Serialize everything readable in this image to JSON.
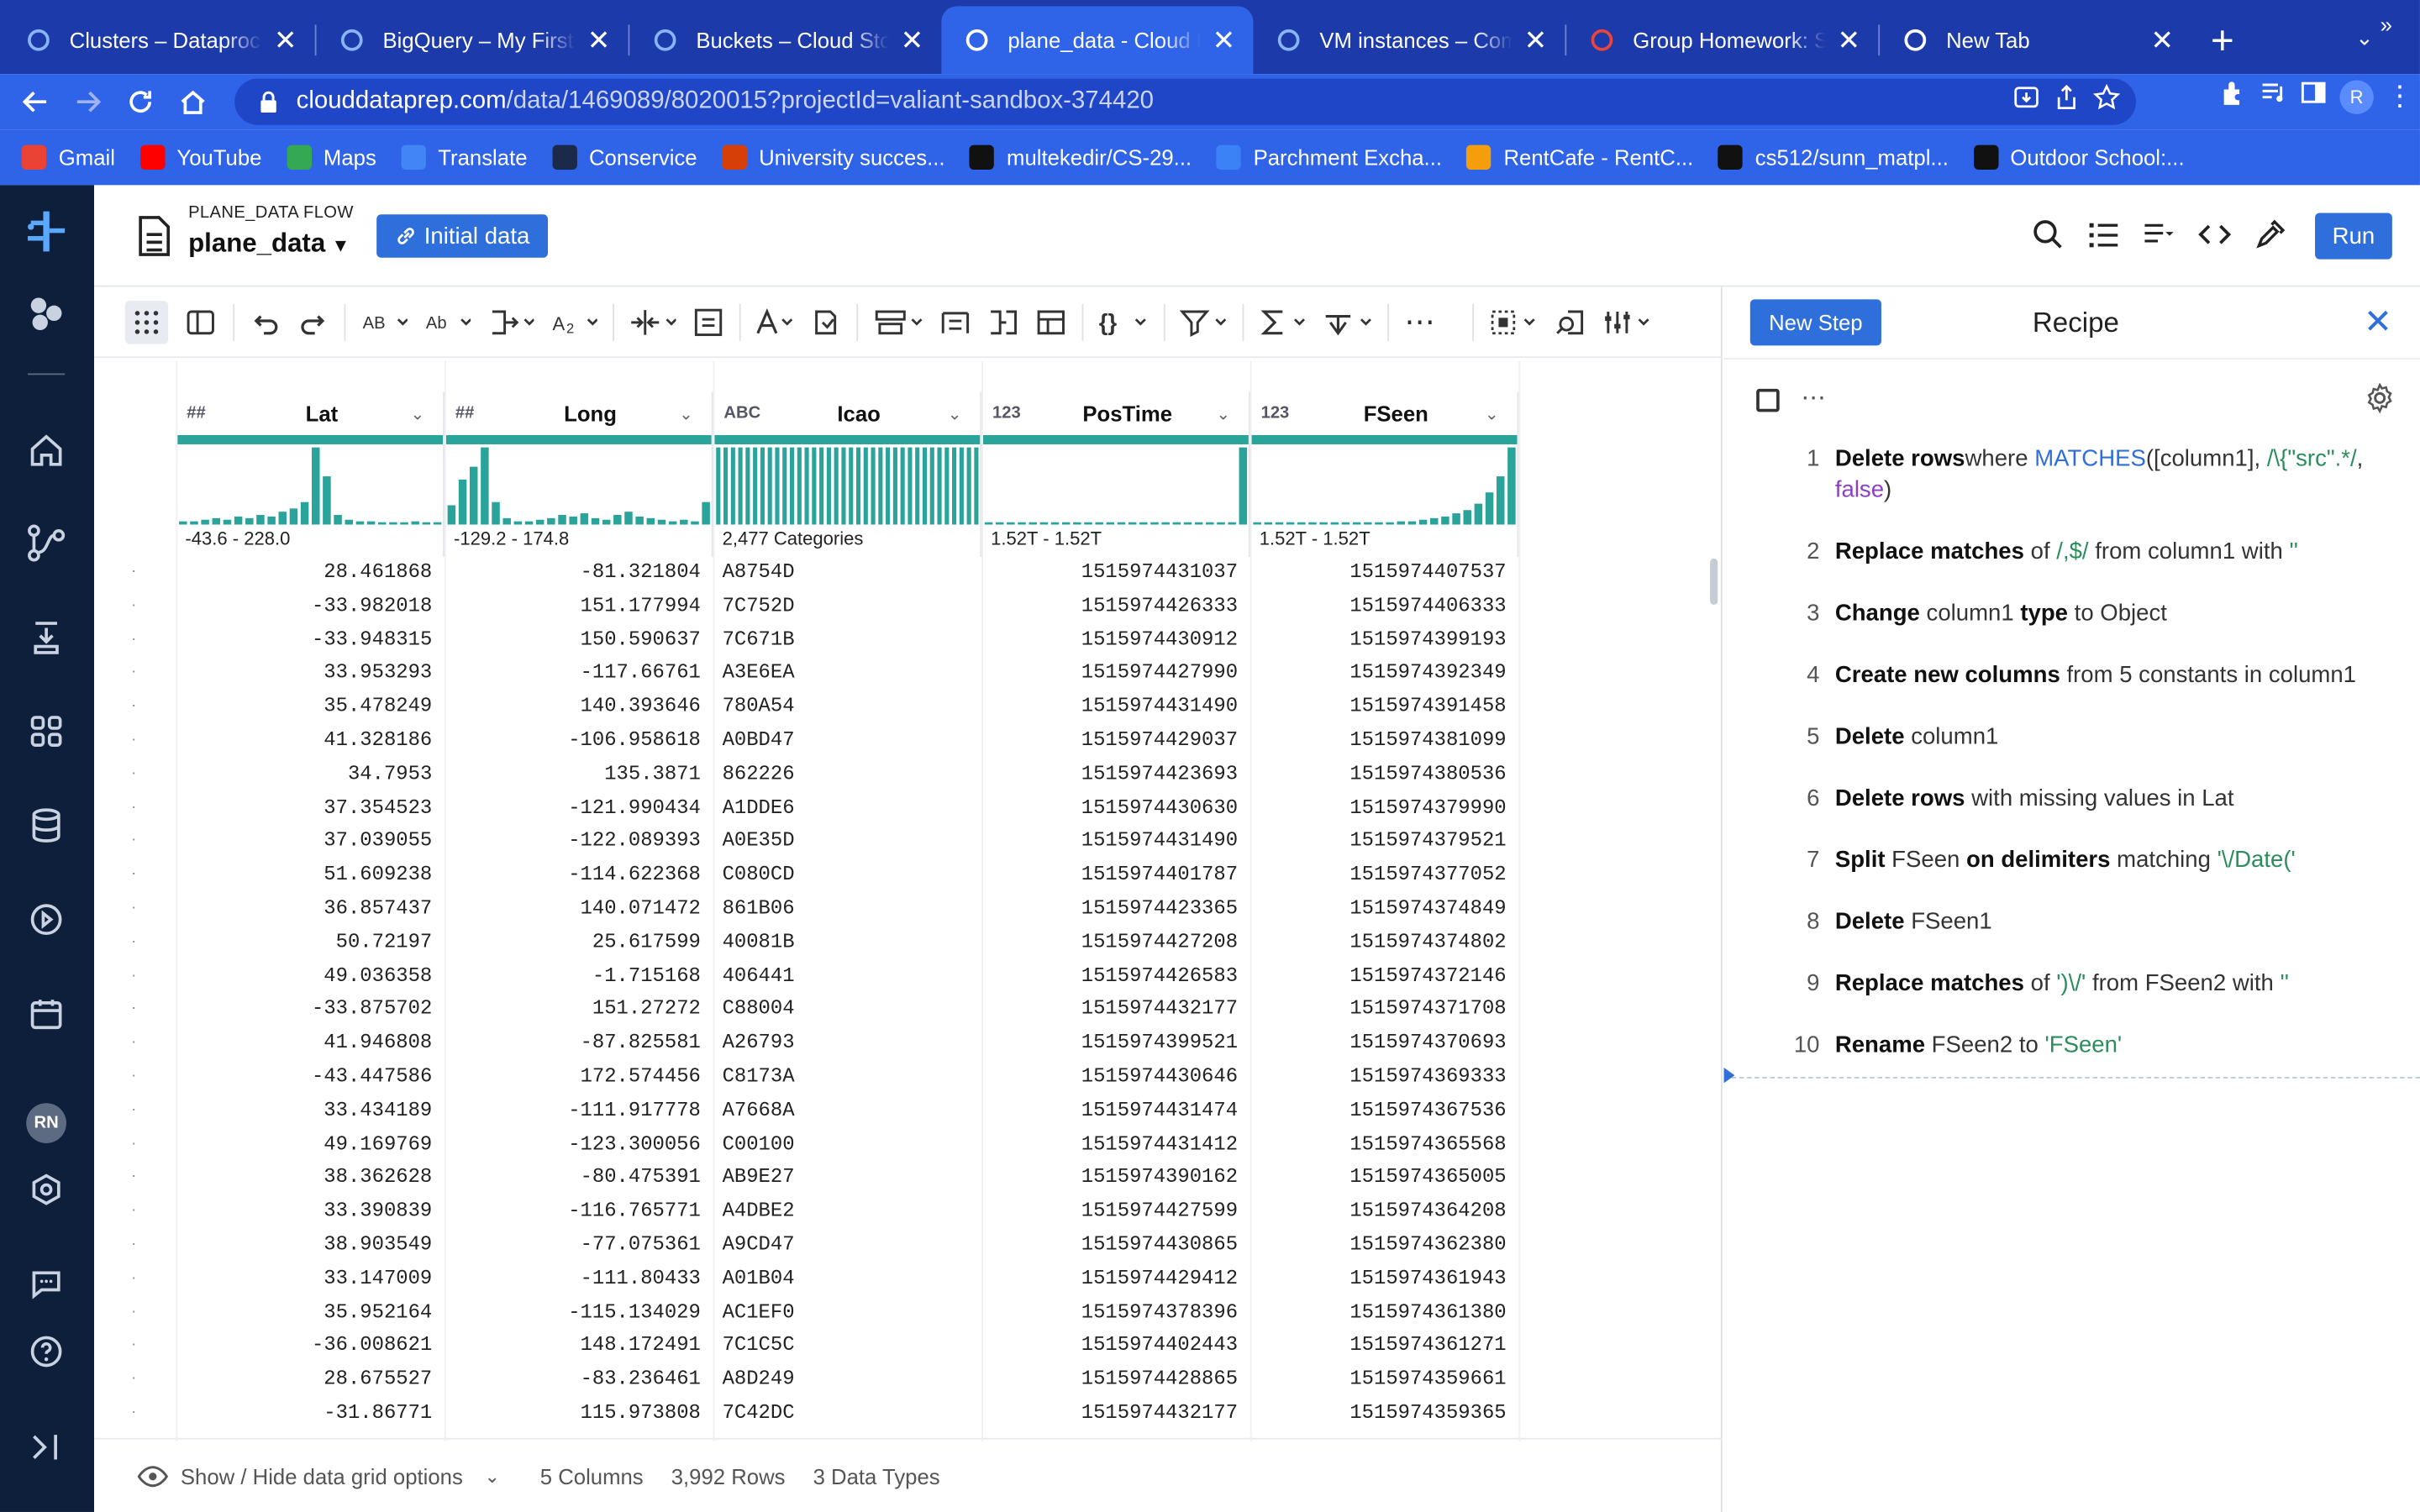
{
  "browser": {
    "tabs": [
      {
        "title": "Clusters – Dataproc –",
        "color": "#8ab4f8"
      },
      {
        "title": "BigQuery – My First P",
        "color": "#8ab4f8"
      },
      {
        "title": "Buckets – Cloud Stora",
        "color": "#8ab4f8"
      },
      {
        "title": "plane_data - Cloud Da",
        "color": "#ffffff"
      },
      {
        "title": "VM instances – Comp",
        "color": "#8ab4f8"
      },
      {
        "title": "Group Homework: Sp",
        "color": "#e8453c"
      },
      {
        "title": "New Tab",
        "color": "#ffffff"
      }
    ],
    "active_tab": 3,
    "url_domain": "clouddataprep.com",
    "url_path": "/data/1469089/8020015?projectId=valiant-sandbox-374420",
    "avatar_letter": "R",
    "bookmarks": [
      {
        "label": "Gmail",
        "color": "#ea4335"
      },
      {
        "label": "YouTube",
        "color": "#ff0000"
      },
      {
        "label": "Maps",
        "color": "#34a853"
      },
      {
        "label": "Translate",
        "color": "#4285f4"
      },
      {
        "label": "Conservice",
        "color": "#1b2a48"
      },
      {
        "label": "University succes...",
        "color": "#d73f09"
      },
      {
        "label": "multekedir/CS-29...",
        "color": "#111111"
      },
      {
        "label": "Parchment Excha...",
        "color": "#3b82f6"
      },
      {
        "label": "RentCafe - RentC...",
        "color": "#f59e0b"
      },
      {
        "label": "cs512/sunn_matpl...",
        "color": "#111111"
      },
      {
        "label": "Outdoor School:...",
        "color": "#111111"
      }
    ],
    "bookmarks_more": "»"
  },
  "rail": {
    "user_initials": "RN"
  },
  "header": {
    "flow_label": "PLANE_DATA FLOW",
    "flow_name": "plane_data",
    "initial_data_button": "Initial data",
    "run_button": "Run"
  },
  "columns": [
    {
      "type_icon": "##",
      "name": "Lat",
      "range": "-43.6 - 228.0",
      "hist": [
        2,
        2,
        3,
        4,
        3,
        5,
        4,
        6,
        5,
        8,
        10,
        14,
        48,
        30,
        6,
        3,
        2,
        2,
        1,
        1,
        1,
        2,
        1,
        1
      ]
    },
    {
      "type_icon": "##",
      "name": "Long",
      "range": "-129.2 - 174.8",
      "hist": [
        12,
        28,
        36,
        48,
        14,
        4,
        2,
        2,
        3,
        4,
        6,
        5,
        7,
        4,
        3,
        6,
        8,
        5,
        4,
        3,
        2,
        3,
        2,
        14
      ]
    },
    {
      "type_icon": "ABC",
      "name": "Icao",
      "range": "2,477 Categories",
      "hist": [
        48,
        48,
        48,
        48,
        48,
        48,
        48,
        48,
        48,
        48,
        48,
        48,
        48,
        48,
        48,
        48,
        48,
        48,
        48,
        48,
        48,
        48,
        48,
        48,
        48,
        48,
        48,
        48,
        48,
        48,
        48,
        48,
        48,
        48,
        48,
        48
      ]
    },
    {
      "type_icon": "123",
      "name": "PosTime",
      "range": "1.52T - 1.52T",
      "hist": [
        1,
        1,
        1,
        1,
        1,
        1,
        1,
        1,
        1,
        1,
        1,
        1,
        1,
        1,
        1,
        1,
        1,
        1,
        1,
        1,
        1,
        1,
        1,
        48
      ]
    },
    {
      "type_icon": "123",
      "name": "FSeen",
      "range": "1.52T - 1.52T",
      "hist": [
        1,
        1,
        1,
        1,
        1,
        1,
        1,
        1,
        1,
        1,
        1,
        1,
        1,
        2,
        2,
        3,
        4,
        5,
        7,
        9,
        13,
        20,
        30,
        48
      ]
    }
  ],
  "rows": [
    [
      "28.461868",
      "-81.321804",
      "A8754D",
      "1515974431037",
      "1515974407537"
    ],
    [
      "-33.982018",
      "151.177994",
      "7C752D",
      "1515974426333",
      "1515974406333"
    ],
    [
      "-33.948315",
      "150.590637",
      "7C671B",
      "1515974430912",
      "1515974399193"
    ],
    [
      "33.953293",
      "-117.66761",
      "A3E6EA",
      "1515974427990",
      "1515974392349"
    ],
    [
      "35.478249",
      "140.393646",
      "780A54",
      "1515974431490",
      "1515974391458"
    ],
    [
      "41.328186",
      "-106.958618",
      "A0BD47",
      "1515974429037",
      "1515974381099"
    ],
    [
      "34.7953",
      "135.3871",
      "862226",
      "1515974423693",
      "1515974380536"
    ],
    [
      "37.354523",
      "-121.990434",
      "A1DDE6",
      "1515974430630",
      "1515974379990"
    ],
    [
      "37.039055",
      "-122.089393",
      "A0E35D",
      "1515974431490",
      "1515974379521"
    ],
    [
      "51.609238",
      "-114.622368",
      "C080CD",
      "1515974401787",
      "1515974377052"
    ],
    [
      "36.857437",
      "140.071472",
      "861B06",
      "1515974423365",
      "1515974374849"
    ],
    [
      "50.72197",
      "25.617599",
      "40081B",
      "1515974427208",
      "1515974374802"
    ],
    [
      "49.036358",
      "-1.715168",
      "406441",
      "1515974426583",
      "1515974372146"
    ],
    [
      "-33.875702",
      "151.27272",
      "C88004",
      "1515974432177",
      "1515974371708"
    ],
    [
      "41.946808",
      "-87.825581",
      "A26793",
      "1515974399521",
      "1515974370693"
    ],
    [
      "-43.447586",
      "172.574456",
      "C8173A",
      "1515974430646",
      "1515974369333"
    ],
    [
      "33.434189",
      "-111.917778",
      "A7668A",
      "1515974431474",
      "1515974367536"
    ],
    [
      "49.169769",
      "-123.300056",
      "C00100",
      "1515974431412",
      "1515974365568"
    ],
    [
      "38.362628",
      "-80.475391",
      "AB9E27",
      "1515974390162",
      "1515974365005"
    ],
    [
      "33.390839",
      "-116.765771",
      "A4DBE2",
      "1515974427599",
      "1515974364208"
    ],
    [
      "38.903549",
      "-77.075361",
      "A9CD47",
      "1515974430865",
      "1515974362380"
    ],
    [
      "33.147009",
      "-111.80433",
      "A01B04",
      "1515974429412",
      "1515974361943"
    ],
    [
      "35.952164",
      "-115.134029",
      "AC1EF0",
      "1515974378396",
      "1515974361380"
    ],
    [
      "-36.008621",
      "148.172491",
      "7C1C5C",
      "1515974402443",
      "1515974361271"
    ],
    [
      "28.675527",
      "-83.236461",
      "A8D249",
      "1515974428865",
      "1515974359661"
    ],
    [
      "-31.86771",
      "115.973808",
      "7C42DC",
      "1515974432177",
      "1515974359365"
    ]
  ],
  "footer": {
    "show_hide": "Show / Hide data grid options",
    "columns": "5 Columns",
    "rows": "3,992 Rows",
    "types": "3 Data Types"
  },
  "recipe": {
    "new_step_button": "New Step",
    "title": "Recipe",
    "steps": [
      {
        "n": "1",
        "parts": [
          [
            "b",
            "Delete rows"
          ],
          [
            "",
            "where "
          ],
          [
            "bl",
            "MATCHES"
          ],
          [
            "",
            "([column1], "
          ],
          [
            "g",
            "/\\{\"src\".*/"
          ],
          [
            "",
            ", "
          ],
          [
            "p",
            "false"
          ],
          [
            "",
            ")"
          ]
        ]
      },
      {
        "n": "2",
        "parts": [
          [
            "b",
            "Replace matches"
          ],
          [
            "",
            " of "
          ],
          [
            "g",
            "/,$/"
          ],
          [
            "",
            " from column1 with "
          ],
          [
            "g",
            "''"
          ]
        ]
      },
      {
        "n": "3",
        "parts": [
          [
            "b",
            "Change"
          ],
          [
            "",
            " column1 "
          ],
          [
            "b",
            "type"
          ],
          [
            "",
            " to Object"
          ]
        ]
      },
      {
        "n": "4",
        "parts": [
          [
            "b",
            "Create new columns"
          ],
          [
            "",
            " from 5 constants in column1"
          ]
        ]
      },
      {
        "n": "5",
        "parts": [
          [
            "b",
            "Delete"
          ],
          [
            "",
            " column1"
          ]
        ]
      },
      {
        "n": "6",
        "parts": [
          [
            "b",
            "Delete rows"
          ],
          [
            "",
            " with missing values in Lat"
          ]
        ]
      },
      {
        "n": "7",
        "parts": [
          [
            "b",
            "Split"
          ],
          [
            "",
            " FSeen "
          ],
          [
            "b",
            "on delimiters"
          ],
          [
            "",
            " matching "
          ],
          [
            "g",
            "'\\/Date('"
          ]
        ]
      },
      {
        "n": "8",
        "parts": [
          [
            "b",
            "Delete"
          ],
          [
            "",
            " FSeen1"
          ]
        ]
      },
      {
        "n": "9",
        "parts": [
          [
            "b",
            "Replace matches"
          ],
          [
            "",
            " of "
          ],
          [
            "g",
            "')\\/'"
          ],
          [
            "",
            " from FSeen2 with "
          ],
          [
            "g",
            "''"
          ]
        ]
      },
      {
        "n": "10",
        "parts": [
          [
            "b",
            "Rename"
          ],
          [
            "",
            " FSeen2 to "
          ],
          [
            "g",
            "'FSeen'"
          ]
        ]
      }
    ]
  }
}
